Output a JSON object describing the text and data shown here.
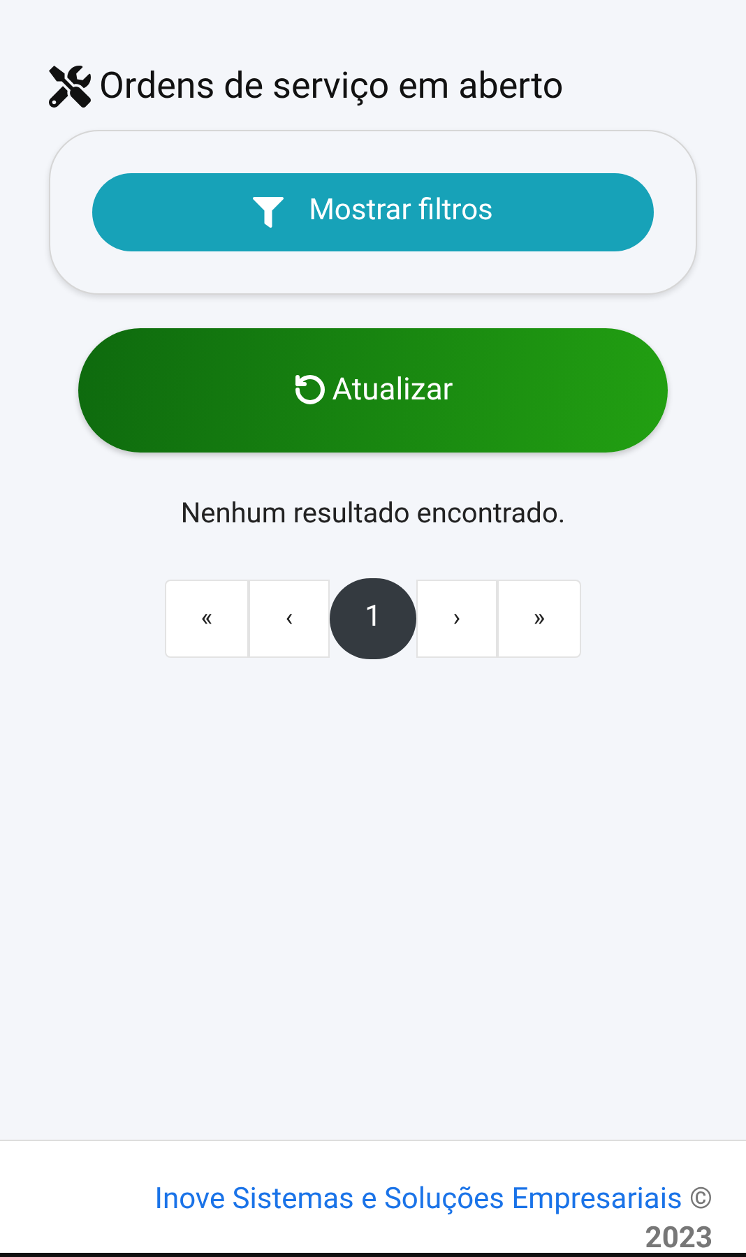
{
  "title": "Ordens de serviço em aberto",
  "filters_button": {
    "label": "Mostrar filtros"
  },
  "refresh_button": {
    "label": "Atualizar"
  },
  "empty_message": "Nenhum resultado encontrado.",
  "pagination": [
    {
      "kind": "first",
      "label": "«",
      "selected": false
    },
    {
      "kind": "prev",
      "label": "‹",
      "selected": false
    },
    {
      "kind": "page",
      "label": "1",
      "selected": true
    },
    {
      "kind": "next",
      "label": "›",
      "selected": false
    },
    {
      "kind": "last",
      "label": "»",
      "selected": false
    }
  ],
  "footer": {
    "company_link": "Inove Sistemas e Soluções Empresariais",
    "copyright": "©",
    "year": "2023"
  }
}
